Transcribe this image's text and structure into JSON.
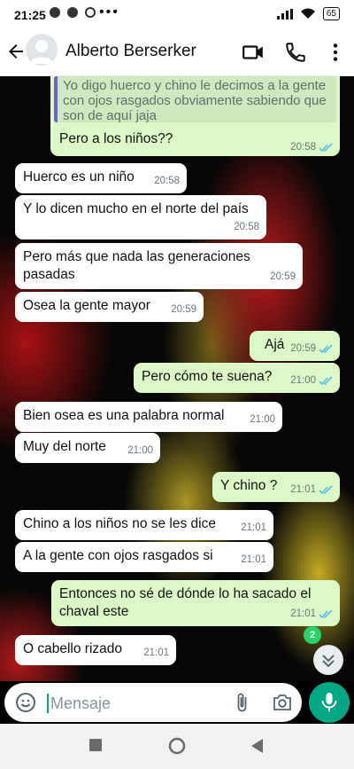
{
  "status_bar": {
    "time": "21:25",
    "more": "•••",
    "battery": "65"
  },
  "header": {
    "contact_name": "Alberto Berserker"
  },
  "colors": {
    "accent": "#00a884",
    "outgoing": "#dcf8c6",
    "incoming": "#ffffff",
    "read_ticks": "#53bdeb",
    "quote_bar": "#6c5fd1"
  },
  "messages": [
    {
      "dir": "out",
      "quote": "Yo digo huerco y chino le decimos a la gente con ojos rasgados obviamente sabiendo que son de aquí jaja",
      "text": "Pero a los niños??",
      "time": "20:58"
    },
    {
      "dir": "in",
      "text": "Huerco es un niño",
      "time": "20:58"
    },
    {
      "dir": "in",
      "text": "Y lo dicen mucho en el norte del país",
      "time": "20:58"
    },
    {
      "dir": "in",
      "text": "Pero más que nada las generaciones pasadas",
      "time": "20:59"
    },
    {
      "dir": "in",
      "text": "Osea la gente mayor",
      "time": "20:59"
    },
    {
      "dir": "out",
      "text": "Ajá",
      "time": "20:59"
    },
    {
      "dir": "out",
      "text": "Pero cómo te suena?",
      "time": "21:00"
    },
    {
      "dir": "in",
      "text": "Bien osea es una palabra normal",
      "time": "21:00"
    },
    {
      "dir": "in",
      "text": "Muy del norte",
      "time": "21:00"
    },
    {
      "dir": "out",
      "text": "Y chino ?",
      "time": "21:01"
    },
    {
      "dir": "in",
      "text": "Chino a los niños no se les dice",
      "time": "21:01"
    },
    {
      "dir": "in",
      "text": "A la gente con ojos rasgados si",
      "time": "21:01"
    },
    {
      "dir": "out",
      "text": "Entonces no sé de dónde lo ha sacado el chaval este",
      "time": "21:01"
    },
    {
      "dir": "in",
      "text": "O cabello rizado",
      "time": "21:01"
    }
  ],
  "unread_count": "2",
  "composer": {
    "placeholder": "Mensaje"
  },
  "icons": [
    "back-arrow-icon",
    "avatar-icon",
    "video-call-icon",
    "phone-icon",
    "more-vert-icon",
    "emoji-icon",
    "attach-icon",
    "camera-icon",
    "mic-icon",
    "scroll-down-icon"
  ]
}
